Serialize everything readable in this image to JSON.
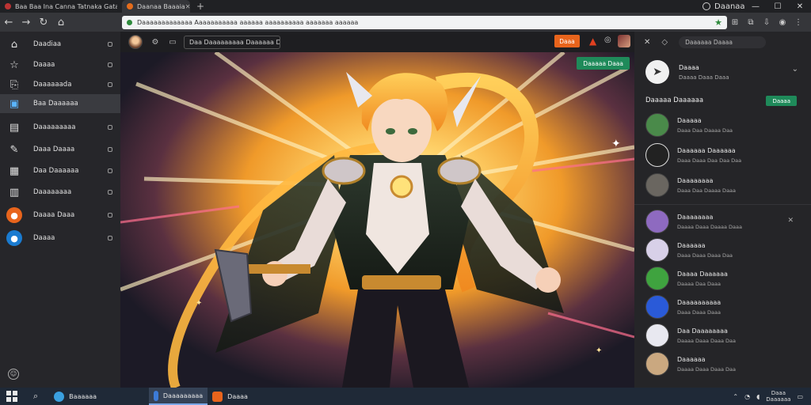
{
  "browser": {
    "tabs": [
      {
        "label": "Baa Baa Ina Canna Tatnaka Gata Taanas"
      },
      {
        "label": "Daanaa Baaaia"
      }
    ],
    "new_tab": "+",
    "account_label": "Daanaa",
    "window_controls": {
      "minimize": "—",
      "maximize": "☐",
      "close": "✕"
    },
    "url": "Daaaaaaaaaaaaa Aaaaaaaaaaa aaaaaa aaaaaaaaaa aaaaaaa aaaaaa"
  },
  "sidebar": {
    "items": [
      {
        "icon": "home-icon",
        "glyph": "⌂",
        "label": "Daadiaa"
      },
      {
        "icon": "star-icon",
        "glyph": "☆",
        "label": "Daaaa"
      },
      {
        "icon": "share-icon",
        "glyph": "⎘",
        "label": "Daaaaaada"
      },
      {
        "icon": "bookmark-icon",
        "glyph": "▣",
        "label": "Baa Daaaaaa",
        "active": true
      },
      {
        "icon": "note-icon",
        "glyph": "▤",
        "label": "Daaaaaaaaa"
      },
      {
        "icon": "pencil-icon",
        "glyph": "✎",
        "label": "Daaa Daaaa"
      },
      {
        "icon": "document-icon",
        "glyph": "▦",
        "label": "Daa Daaaaaa"
      },
      {
        "icon": "book-icon",
        "glyph": "▥",
        "label": "Daaaaaaaa"
      },
      {
        "icon": "firefox-icon",
        "glyph": "●",
        "label": "Daaaa Daaa"
      },
      {
        "icon": "user-icon",
        "glyph": "●",
        "label": "Daaaa"
      }
    ]
  },
  "content_header": {
    "path": "Daa Daaaaaaaaa Daaaaaa Daaa",
    "action_button": "Daaa"
  },
  "artwork": {
    "badge": "Daaaaa Daaa"
  },
  "right_panel": {
    "search_placeholder": "Daaaaaa Daaaa",
    "profile": {
      "name": "Daaaa",
      "meta": "Daaaa Daaa Daaa"
    },
    "section_title": "Daaaaa Daaaaaa",
    "follow_button": "Daaaa",
    "items": [
      {
        "thumb": "#4a8a4a",
        "name": "Daaaaa",
        "meta": "Daaa Daa Daaaa Daa"
      },
      {
        "thumb": "#222222",
        "name": "Daaaaaa Daaaaaa",
        "meta": "Daaa Daaa Daa Daa Daa"
      },
      {
        "thumb": "#6a6660",
        "name": "Daaaaaaaa",
        "meta": "Daaa Daa Daaaa Daaa"
      },
      {
        "thumb": "#8e6ac0",
        "name": "Daaaaaaaa",
        "meta": "Daaaa Daaa Daaaa Daaa"
      },
      {
        "thumb": "#d8d0e8",
        "name": "Daaaaaa",
        "meta": "Daaa Daaa Daaa Daa"
      },
      {
        "thumb": "#3fa33f",
        "name": "Daaaa Daaaaaa",
        "meta": "Daaaa Daa Daaa"
      },
      {
        "thumb": "#2a5ad8",
        "name": "Daaaaaaaaaa",
        "meta": "Daaa Daaa Daaa"
      },
      {
        "thumb": "#e8e8f0",
        "name": "Daa Daaaaaaaa",
        "meta": "Daaaa Daaa Daaa Daa"
      },
      {
        "thumb": "#caa880",
        "name": "Daaaaaa",
        "meta": "Daaaa Daaa Daaa Daa"
      }
    ]
  },
  "taskbar": {
    "apps": [
      {
        "label": "Baaaaaa",
        "color": "#3aa0e0"
      },
      {
        "label": "Daaaaaaaaa",
        "color": "#3c7bd8",
        "selected": true
      },
      {
        "label": "Daaaa",
        "color": "#e8641c"
      }
    ],
    "clock_time": "Daaa",
    "clock_date": "Daaaaaa"
  }
}
